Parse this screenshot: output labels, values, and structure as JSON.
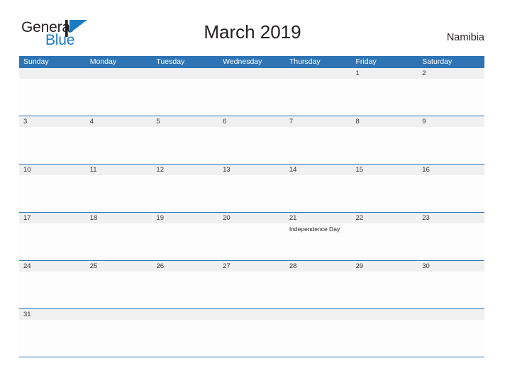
{
  "brand": {
    "word_one": "General",
    "word_two": "Blue",
    "mark_icon": "triangle-flag-icon",
    "color_dark": "#231f20",
    "color_blue": "#1a7bc4"
  },
  "header": {
    "title": "March 2019",
    "region": "Namibia"
  },
  "theme": {
    "header_blue": "#2e74b5",
    "band_gray": "#f0f0f0",
    "rule_blue": "#2e74b5",
    "text_dark": "#231f20"
  },
  "calendar": {
    "day_headers": [
      "Sunday",
      "Monday",
      "Tuesday",
      "Wednesday",
      "Thursday",
      "Friday",
      "Saturday"
    ],
    "weeks": [
      {
        "days": [
          {
            "date": "",
            "event": ""
          },
          {
            "date": "",
            "event": ""
          },
          {
            "date": "",
            "event": ""
          },
          {
            "date": "",
            "event": ""
          },
          {
            "date": "",
            "event": ""
          },
          {
            "date": "1",
            "event": ""
          },
          {
            "date": "2",
            "event": ""
          }
        ]
      },
      {
        "days": [
          {
            "date": "3",
            "event": ""
          },
          {
            "date": "4",
            "event": ""
          },
          {
            "date": "5",
            "event": ""
          },
          {
            "date": "6",
            "event": ""
          },
          {
            "date": "7",
            "event": ""
          },
          {
            "date": "8",
            "event": ""
          },
          {
            "date": "9",
            "event": ""
          }
        ]
      },
      {
        "days": [
          {
            "date": "10",
            "event": ""
          },
          {
            "date": "11",
            "event": ""
          },
          {
            "date": "12",
            "event": ""
          },
          {
            "date": "13",
            "event": ""
          },
          {
            "date": "14",
            "event": ""
          },
          {
            "date": "15",
            "event": ""
          },
          {
            "date": "16",
            "event": ""
          }
        ]
      },
      {
        "days": [
          {
            "date": "17",
            "event": ""
          },
          {
            "date": "18",
            "event": ""
          },
          {
            "date": "19",
            "event": ""
          },
          {
            "date": "20",
            "event": ""
          },
          {
            "date": "21",
            "event": "Independence Day"
          },
          {
            "date": "22",
            "event": ""
          },
          {
            "date": "23",
            "event": ""
          }
        ]
      },
      {
        "days": [
          {
            "date": "24",
            "event": ""
          },
          {
            "date": "25",
            "event": ""
          },
          {
            "date": "26",
            "event": ""
          },
          {
            "date": "27",
            "event": ""
          },
          {
            "date": "28",
            "event": ""
          },
          {
            "date": "29",
            "event": ""
          },
          {
            "date": "30",
            "event": ""
          }
        ]
      },
      {
        "days": [
          {
            "date": "31",
            "event": ""
          },
          {
            "date": "",
            "event": ""
          },
          {
            "date": "",
            "event": ""
          },
          {
            "date": "",
            "event": ""
          },
          {
            "date": "",
            "event": ""
          },
          {
            "date": "",
            "event": ""
          },
          {
            "date": "",
            "event": ""
          }
        ]
      }
    ]
  }
}
